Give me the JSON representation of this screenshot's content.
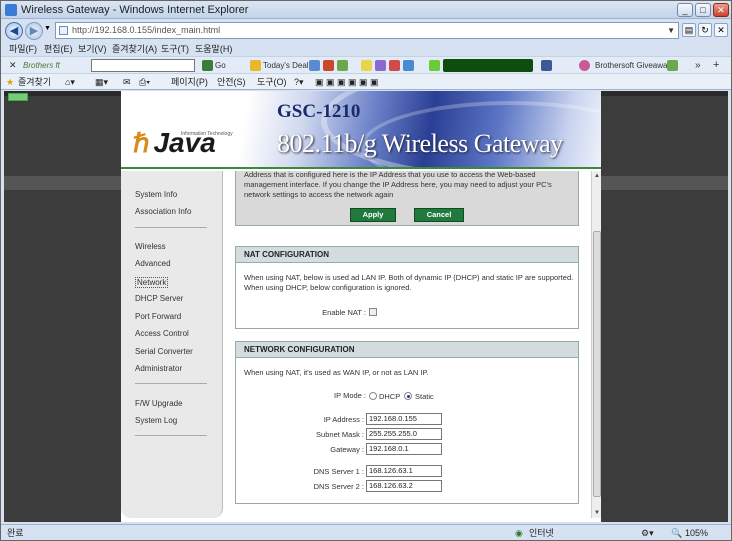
{
  "window": {
    "title": "Wireless Gateway - Windows Internet Explorer"
  },
  "address": {
    "url": "http://192.168.0.155/index_main.html"
  },
  "menu": [
    "파일(F)",
    "편집(E)",
    "보기(V)",
    "즐겨찾기(A)",
    "도구(T)",
    "도움말(H)"
  ],
  "toolbar": {
    "brand": "Brothers ft",
    "go": "Go",
    "deal": "Today's Deal",
    "giveaway": "Brothersoft Giveaway"
  },
  "favbar": {
    "favorites": "즐겨찾기",
    "page": "페이지(P)",
    "safety": "안전(S)",
    "tools": "도구(O)"
  },
  "banner": {
    "model": "GSC-1210",
    "product": "802.11b/g Wireless Gateway",
    "logo": "Java",
    "tagline": "Information Technology"
  },
  "sidebar": {
    "items1": [
      "System Info",
      "Association Info"
    ],
    "items2": [
      "Wireless",
      "Advanced",
      "Network",
      "DHCP Server",
      "Port Forward",
      "Access Control",
      "Serial Converter",
      "Administrator"
    ],
    "items3": [
      "F/W Upgrade",
      "System Log"
    ]
  },
  "ipbox": {
    "text": "Address that is configured here is the IP Address that you use to access the Web-based management interface. If you change the IP Address here, you may need to adjust your PC's network settings to access the network again",
    "apply": "Apply",
    "cancel": "Cancel"
  },
  "nat": {
    "header": "NAT CONFIGURATION",
    "text": "When using NAT, below is used ad LAN IP. Both of dynamic IP (DHCP) and static IP are supported. When using DHCP, below configuration is ignored.",
    "enable_label": "Enable NAT :",
    "enabled": false
  },
  "network": {
    "header": "NETWORK CONFIGURATION",
    "text": "When using NAT, it's used as WAN IP, or not as LAN IP.",
    "ipmode_label": "IP Mode :",
    "dhcp": "DHCP",
    "static": "Static",
    "mode": "Static",
    "ip_label": "IP Address :",
    "ip": "192.168.0.155",
    "mask_label": "Subnet Mask :",
    "mask": "255.255.255.0",
    "gw_label": "Gateway :",
    "gw": "192.168.0.1",
    "dns1_label": "DNS Server 1 :",
    "dns1": "168.126.63.1",
    "dns2_label": "DNS Server 2 :",
    "dns2": "168.126.63.2"
  },
  "status": {
    "left": "완료",
    "zone": "인터넷",
    "zoom": "105%"
  },
  "colors": {
    "button": "#1f7a3c",
    "header_bg": "#d3dde0",
    "page_bg": "#3c3c3c"
  }
}
